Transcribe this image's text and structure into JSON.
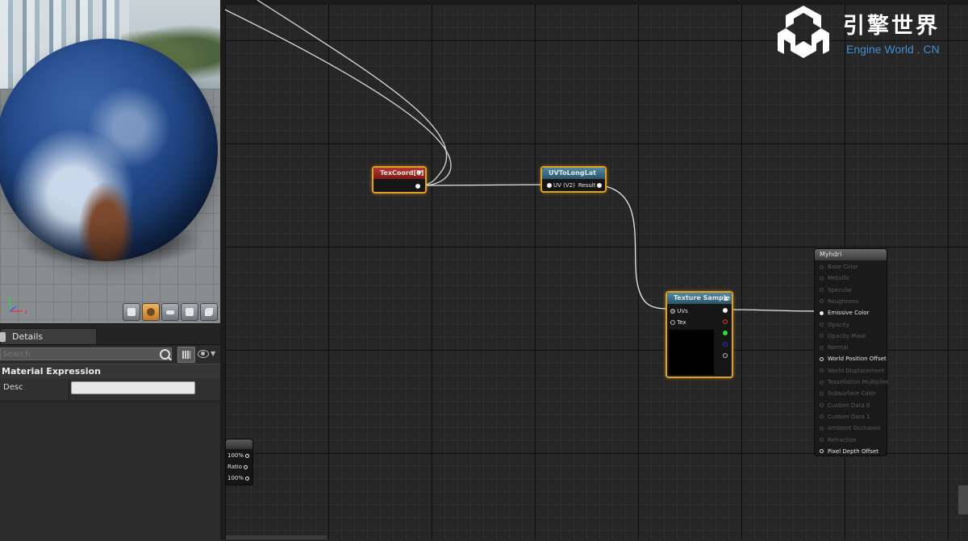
{
  "viewport": {
    "preview_buttons": [
      "cylinder-icon",
      "sphere-icon",
      "plane-icon",
      "cube-icon",
      "custom-mesh-icon"
    ]
  },
  "details": {
    "tab_label": "Details",
    "search_placeholder": "Search",
    "category": "Material Expression",
    "desc_label": "Desc",
    "desc_value": ""
  },
  "graph": {
    "texcoord": {
      "title": "TexCoord[0]"
    },
    "uvtolonglat": {
      "title": "UVToLongLat",
      "input": "UV (V2)",
      "output": "Result"
    },
    "texture_sample": {
      "title": "Texture Sample",
      "inputs": [
        "UVs",
        "Tex"
      ]
    },
    "result": {
      "title": "Myhdri",
      "inputs": [
        {
          "label": "Base Color",
          "active": false
        },
        {
          "label": "Metallic",
          "active": false
        },
        {
          "label": "Specular",
          "active": false
        },
        {
          "label": "Roughness",
          "active": false
        },
        {
          "label": "Emissive Color",
          "active": true
        },
        {
          "label": "Opacity",
          "active": false
        },
        {
          "label": "Opacity Mask",
          "active": false
        },
        {
          "label": "Normal",
          "active": false
        },
        {
          "label": "World Position Offset",
          "active": true
        },
        {
          "label": "World Displacement",
          "active": false
        },
        {
          "label": "Tessellation Multiplier",
          "active": false
        },
        {
          "label": "Subsurface Color",
          "active": false
        },
        {
          "label": "Custom Data 0",
          "active": false
        },
        {
          "label": "Custom Data 1",
          "active": false
        },
        {
          "label": "Ambient Occlusion",
          "active": false
        },
        {
          "label": "Refraction",
          "active": false
        },
        {
          "label": "Pixel Depth Offset",
          "active": true
        }
      ]
    },
    "partial_node": {
      "rows": [
        "100%",
        "Ratio",
        "100%"
      ]
    }
  },
  "logo": {
    "title": "引擎世界",
    "subtitle": "Engine World . CN"
  },
  "colors": {
    "selection": "#e0a020",
    "texcoord_header": "#b8362f",
    "function_header": "#4f8aa6",
    "logo_blue": "#3f8fd6"
  }
}
